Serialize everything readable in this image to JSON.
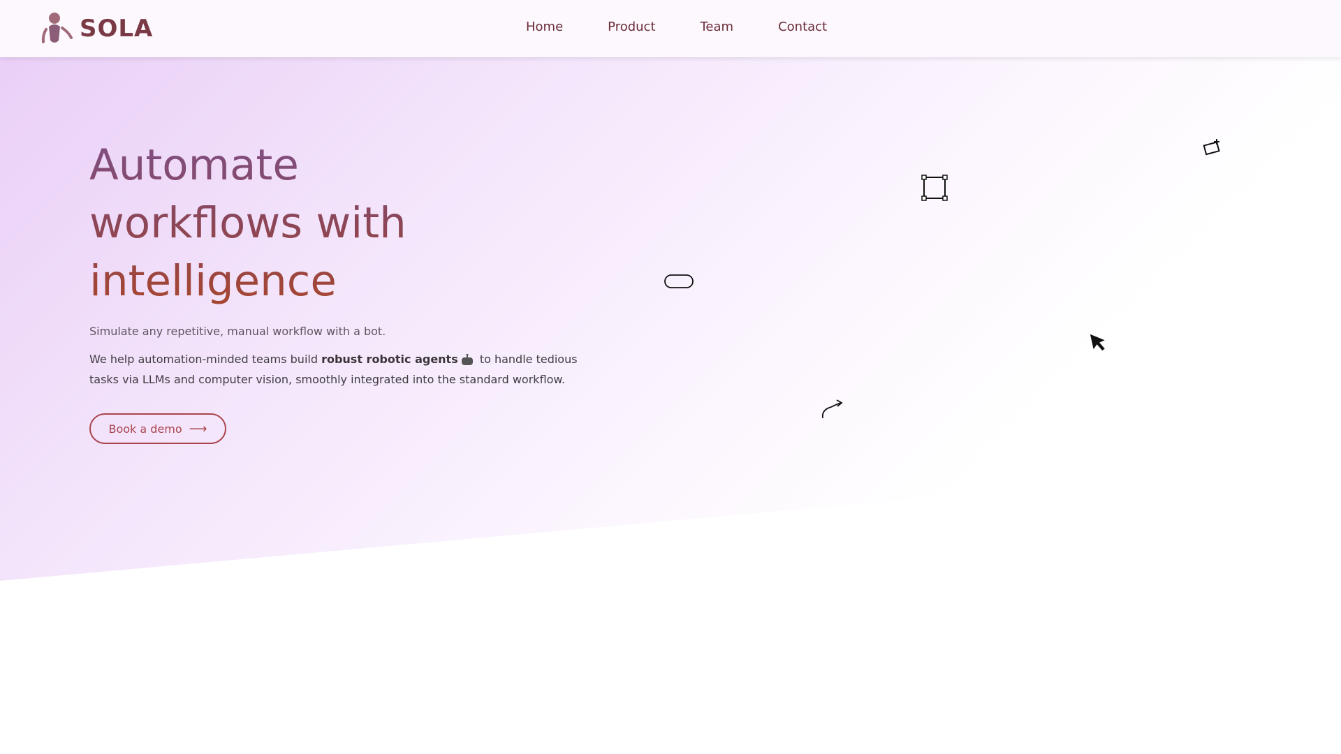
{
  "brand": {
    "name": "SOLA",
    "logo_icon": "robot-figure-icon",
    "color": "#7a3a45"
  },
  "nav": {
    "items": [
      {
        "label": "Home"
      },
      {
        "label": "Product"
      },
      {
        "label": "Team"
      },
      {
        "label": "Contact"
      }
    ]
  },
  "hero": {
    "title_lines": [
      "Automate",
      "workflows with",
      "intelligence"
    ],
    "subtitle": "Simulate any repetitive, manual workflow with a bot.",
    "desc_before": "We help automation-minded teams build ",
    "desc_bold": "robust robotic agents",
    "desc_after": " to handle tedious tasks via LLMs and computer vision, smoothly integrated into the standard workflow.",
    "cta_label": "Book a demo",
    "cta_icon": "arrow-right-icon"
  },
  "decorations": [
    {
      "icon": "sparkle-box-icon"
    },
    {
      "icon": "selection-frame-icon"
    },
    {
      "icon": "pill-shape-icon"
    },
    {
      "icon": "pointer-cursor-icon"
    },
    {
      "icon": "curved-arrow-icon"
    }
  ],
  "colors": {
    "accent": "#a9444c",
    "nav_text": "#6a2c38",
    "gradient_start": "#e9cdf6"
  }
}
